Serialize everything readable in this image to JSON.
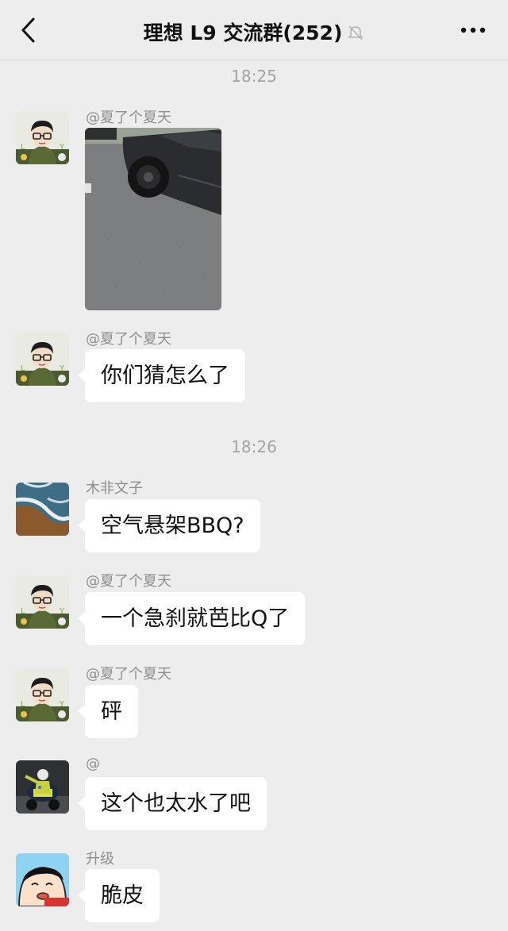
{
  "header": {
    "title": "理想 L9 交流群(252)",
    "back_icon": "chevron-left-icon",
    "mute_icon": "bell-off-icon",
    "more_icon": "more-icon"
  },
  "timestamps": [
    "18:25",
    "18:26"
  ],
  "messages": [
    {
      "sender": "@夏了个夏天",
      "type": "image",
      "image_desc": "car-photo",
      "avatar": "cartoon-man-glasses-avatar"
    },
    {
      "sender": "@夏了个夏天",
      "type": "text",
      "text": "你们猜怎么了",
      "avatar": "cartoon-man-glasses-avatar"
    },
    {
      "sender": "木非文子",
      "type": "text",
      "text": "空气悬架BBQ?",
      "avatar": "beach-waves-avatar"
    },
    {
      "sender": "@夏了个夏天",
      "type": "text",
      "text": "一个急刹就芭比Q了",
      "avatar": "cartoon-man-glasses-avatar"
    },
    {
      "sender": "@夏了个夏天",
      "type": "text",
      "text": "砰",
      "avatar": "cartoon-man-glasses-avatar"
    },
    {
      "sender": "@",
      "type": "text",
      "text": "这个也太水了吧",
      "avatar": "motorcycle-police-avatar"
    },
    {
      "sender": "升级",
      "type": "text",
      "text": "脆皮",
      "avatar": "crayon-shinchan-avatar"
    }
  ],
  "colors": {
    "background": "#ededed",
    "bubble": "#ffffff",
    "name_text": "#8e8e8e",
    "timestamp_text": "#a3a3a3"
  }
}
